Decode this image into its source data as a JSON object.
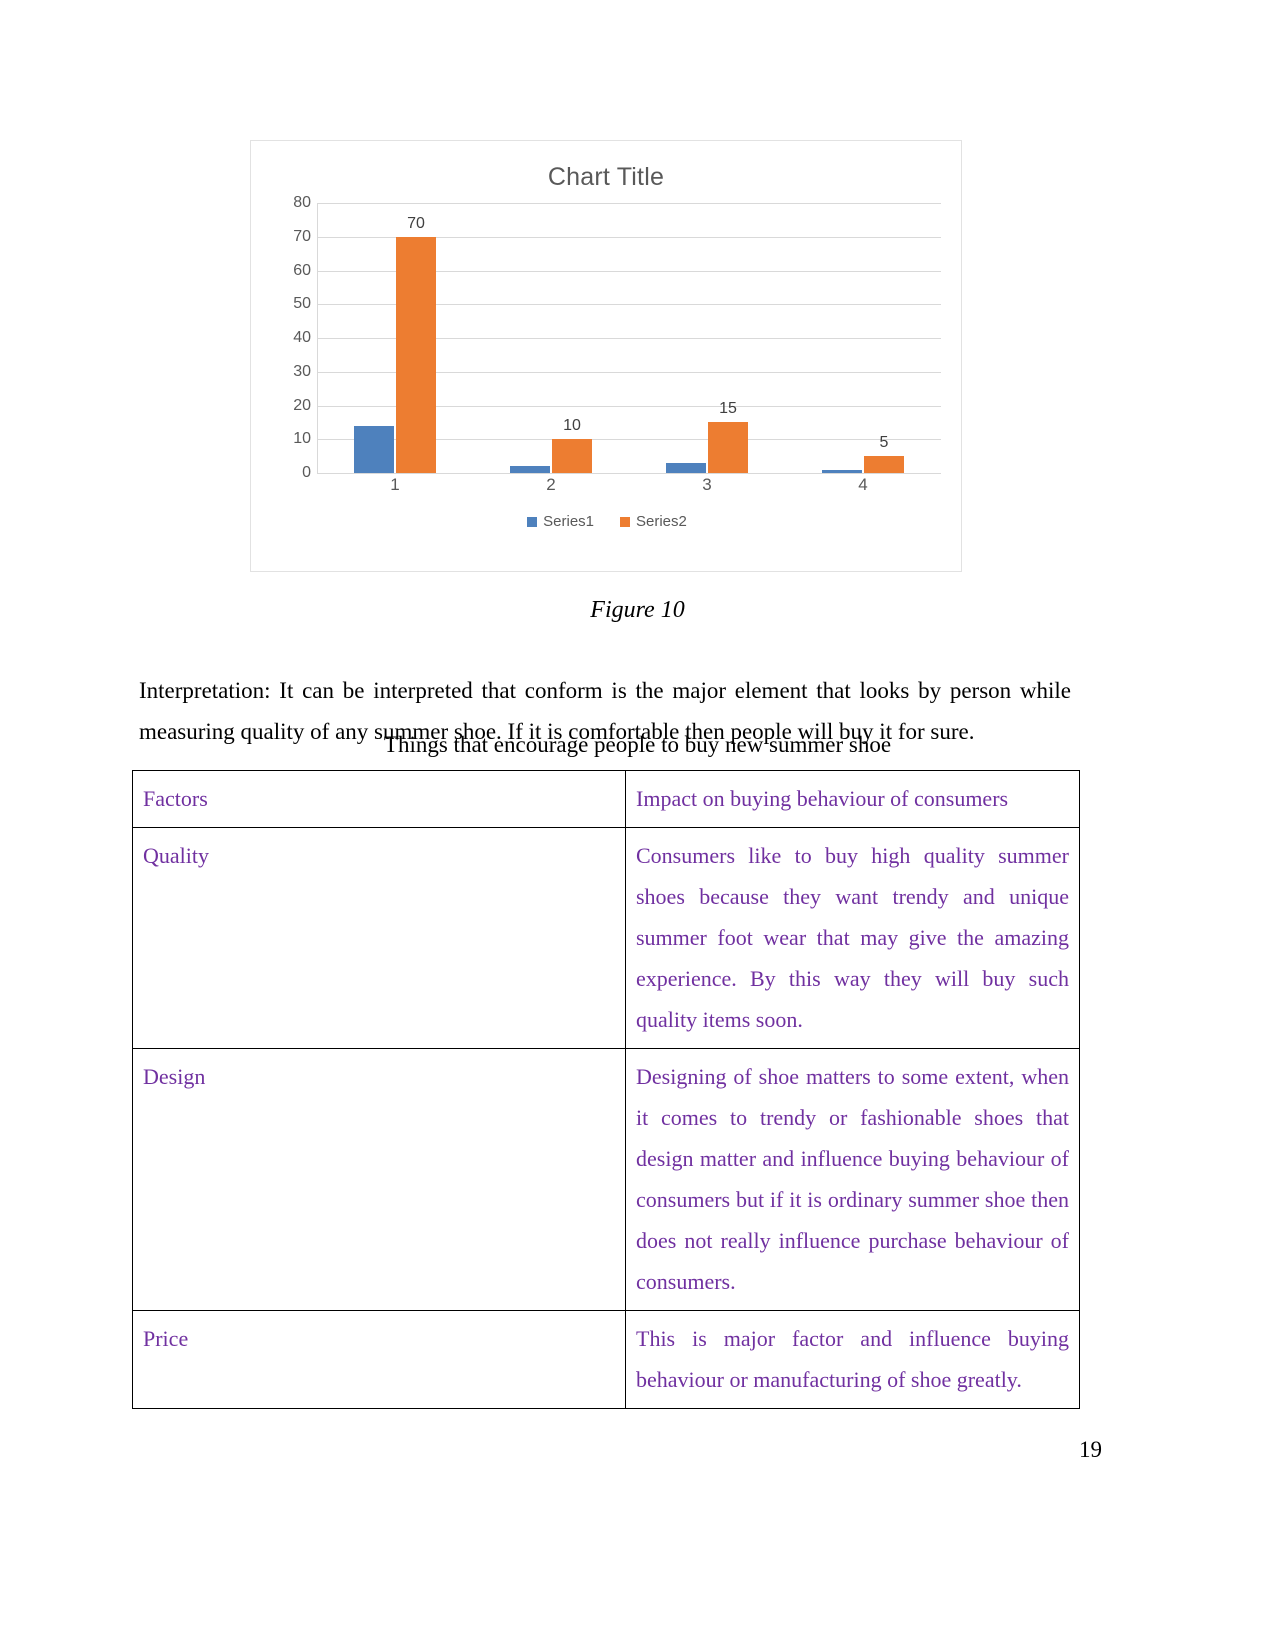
{
  "chart_data": {
    "type": "bar",
    "title": "Chart Title",
    "xlabel": "",
    "ylabel": "",
    "categories": [
      "1",
      "2",
      "3",
      "4"
    ],
    "ylim": [
      0,
      80
    ],
    "yticks": [
      0,
      10,
      20,
      30,
      40,
      50,
      60,
      70,
      80
    ],
    "grid": true,
    "legend_position": "bottom",
    "series": [
      {
        "name": "Series1",
        "color": "#4e81bd",
        "values": [
          14,
          2,
          3,
          1
        ],
        "labels_shown": false
      },
      {
        "name": "Series2",
        "color": "#ed7d31",
        "values": [
          70,
          10,
          15,
          5
        ],
        "labels_shown": true,
        "data_labels": [
          "70",
          "10",
          "15",
          "5"
        ]
      }
    ]
  },
  "figure": {
    "caption": "Figure 10"
  },
  "body": {
    "interpretation": "Interpretation: It can be interpreted that  conform is the major element that looks by person while measuring quality of any summer shoe. If it is comfortable then people will buy it for sure.",
    "table_heading": "Things that encourage people to buy new summer shoe"
  },
  "table": {
    "headers": [
      "Factors",
      "Impact on buying behaviour of consumers"
    ],
    "rows": [
      {
        "factor": "Quality",
        "impact": "Consumers like to buy high quality summer shoes because they want trendy and unique summer foot wear that may give the amazing experience. By this way they will buy such quality items soon."
      },
      {
        "factor": "Design",
        "impact": "Designing of shoe matters to some extent, when it comes to trendy or fashionable shoes that design matter and influence buying behaviour of consumers but if it is ordinary summer shoe then does not really influence purchase behaviour of consumers."
      },
      {
        "factor": "Price",
        "impact": "This is major factor and influence buying behaviour or manufacturing of shoe greatly."
      }
    ]
  },
  "footer": {
    "page_number": "19"
  },
  "colors": {
    "series1": "#4e81bd",
    "series2": "#ed7d31",
    "table_text": "#7030a0",
    "chart_text": "#595959"
  }
}
